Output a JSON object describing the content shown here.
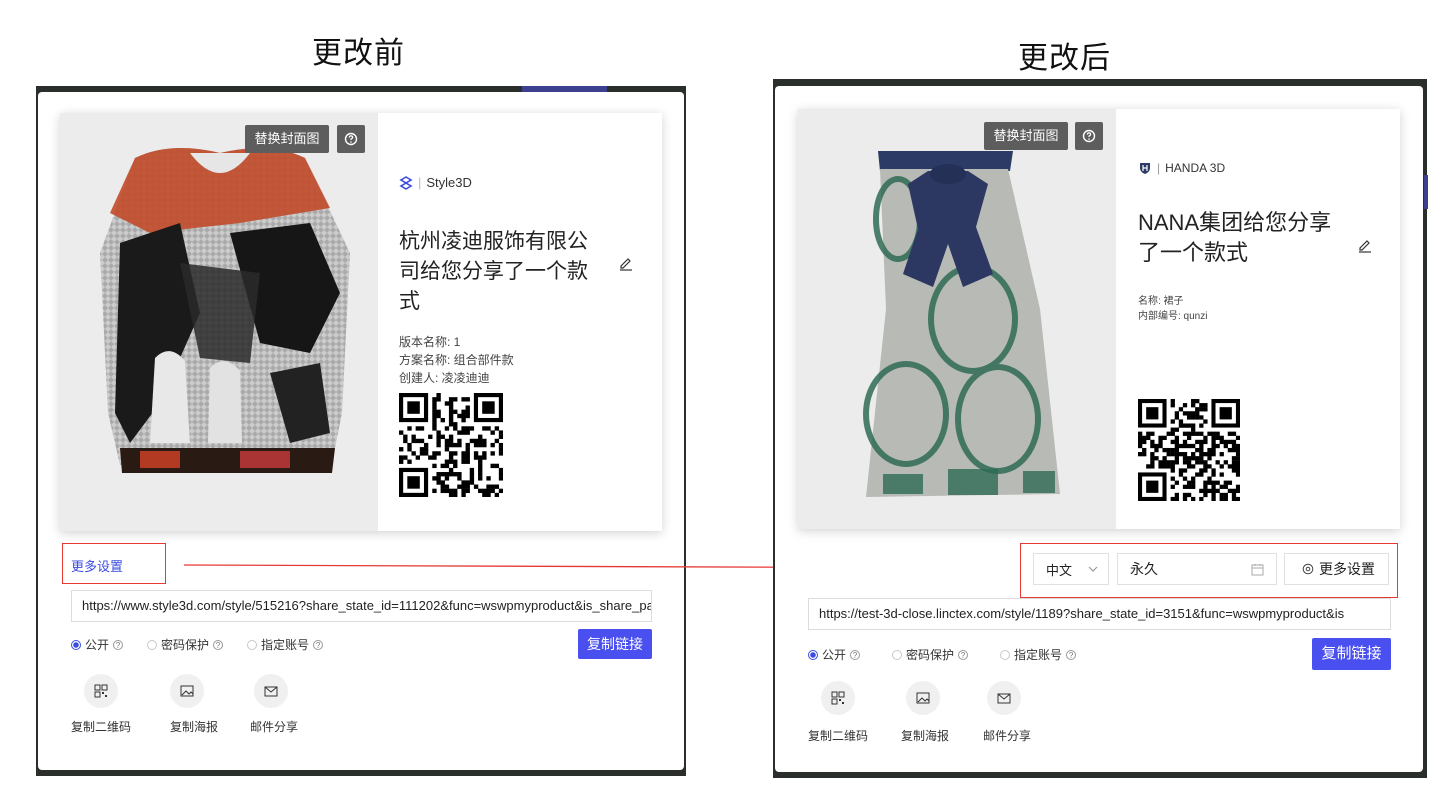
{
  "headings": {
    "before": "更改前",
    "after": "更改后"
  },
  "colors": {
    "accent": "#4a4ff0",
    "annotation": "#e53935"
  },
  "before": {
    "replace_cover": "替换封面图",
    "help_symbol": "?",
    "brand": "Style3D",
    "title": "杭州凌迪服饰有限公司给您分享了一个款式",
    "meta": [
      "版本名称: 1",
      "方案名称: 组合部件款",
      "创建人: 凌凌迪迪"
    ],
    "more_settings": "更多设置",
    "url": "https://www.style3d.com/style/515216?share_state_id=111202&func=wswpmyproduct&is_share_pa",
    "radios": [
      "公开",
      "密码保护",
      "指定账号"
    ],
    "copy_link": "复制链接",
    "share_actions": [
      {
        "label": "复制二维码",
        "icon": "qrcode-icon"
      },
      {
        "label": "复制海报",
        "icon": "image-icon"
      },
      {
        "label": "邮件分享",
        "icon": "mail-icon"
      }
    ]
  },
  "after": {
    "replace_cover": "替换封面图",
    "help_symbol": "?",
    "brand": "HANDA 3D",
    "title": "NANA集团给您分享了一个款式",
    "meta": [
      "名称: 裙子",
      "内部编号: qunzi"
    ],
    "language": "中文",
    "expiry": "永久",
    "more_settings": "更多设置",
    "url": "https://test-3d-close.linctex.com/style/1189?share_state_id=3151&func=wswpmyproduct&is",
    "radios": [
      "公开",
      "密码保护",
      "指定账号"
    ],
    "copy_link": "复制链接",
    "share_actions": [
      {
        "label": "复制二维码",
        "icon": "qrcode-icon"
      },
      {
        "label": "复制海报",
        "icon": "image-icon"
      },
      {
        "label": "邮件分享",
        "icon": "mail-icon"
      }
    ]
  }
}
